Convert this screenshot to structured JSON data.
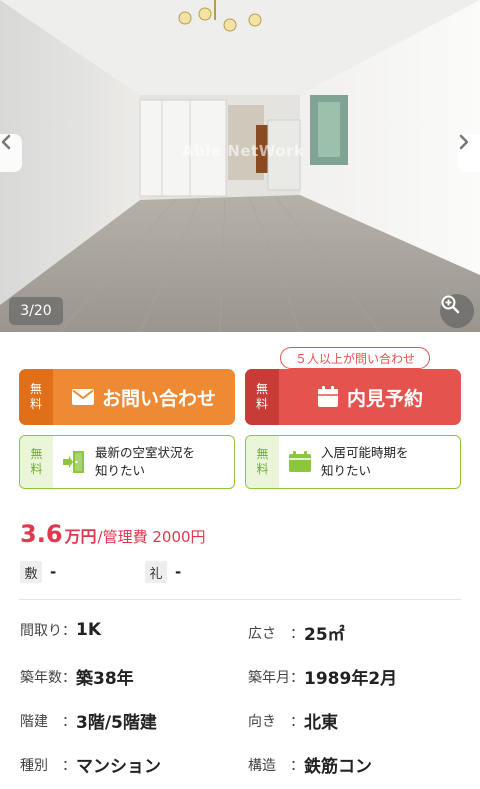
{
  "gallery": {
    "watermark": "Able NetWork",
    "counter": "3/20",
    "prev_icon": "chevron-left-icon",
    "next_icon": "chevron-right-icon",
    "zoom_icon": "zoom-in-icon"
  },
  "actions": {
    "free_label_1": "無",
    "free_label_2": "料",
    "inquiry_label": "お問い合わせ",
    "visit_label": "内見予約",
    "visit_badge": "５人以上が問い合わせ",
    "status_line1": "最新の空室状況を",
    "status_line2": "知りたい",
    "move_line1": "入居可能時期を",
    "move_line2": "知りたい",
    "colors": {
      "orange": "#ef8a34",
      "red": "#e5534f",
      "green": "#8cc63f"
    }
  },
  "price": {
    "amount": "3.6",
    "unit": "万円",
    "separator": "/",
    "fee": "管理費 2000円"
  },
  "deposit": {
    "shiki_label": "敷",
    "shiki_value": "-",
    "rei_label": "礼",
    "rei_value": "-"
  },
  "specs": [
    {
      "key": "間取り：",
      "value": "1K"
    },
    {
      "key": "広さ　：",
      "value": "25㎡"
    },
    {
      "key": "築年数：",
      "value": "築38年"
    },
    {
      "key": "築年月：",
      "value": "1989年2月"
    },
    {
      "key": "階建　：",
      "value": "3階/5階建"
    },
    {
      "key": "向き　：",
      "value": "北東"
    },
    {
      "key": "種別　：",
      "value": "マンション"
    },
    {
      "key": "構造　：",
      "value": "鉄筋コン"
    }
  ]
}
